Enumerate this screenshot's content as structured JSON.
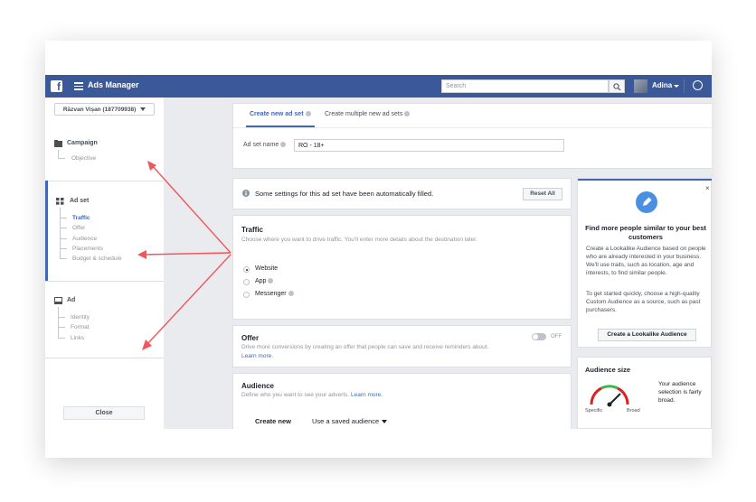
{
  "topbar": {
    "logo": "f",
    "app_title": "Ads Manager",
    "search_placeholder": "Search",
    "user_name": "Adina"
  },
  "sidebar": {
    "account_selector": "Răzvan Vișan (187709938)",
    "campaign": {
      "title": "Campaign",
      "items": [
        "Objective"
      ]
    },
    "adset": {
      "title": "Ad set",
      "items": [
        "Traffic",
        "Offer",
        "Audience",
        "Placements",
        "Budget & schedule"
      ],
      "active_item": "Traffic"
    },
    "ad": {
      "title": "Ad",
      "items": [
        "Identity",
        "Format",
        "Links"
      ]
    },
    "close_label": "Close"
  },
  "adset_header": {
    "tabs": [
      "Create new ad set",
      "Create multiple new ad sets"
    ],
    "active_tab": "Create new ad set",
    "name_label": "Ad set name",
    "name_value": "RO - 18+"
  },
  "notice": {
    "text": "Some settings for this ad set have been automatically filled.",
    "reset_label": "Reset All"
  },
  "traffic": {
    "title": "Traffic",
    "description": "Choose where you want to drive traffic. You'll enter more details about the destination later.",
    "options": [
      "Website",
      "App",
      "Messenger"
    ],
    "selected": "Website"
  },
  "offer": {
    "title": "Offer",
    "description": "Drive more conversions by creating an offer that people can save and receive reminders about.",
    "learn_more": "Learn more.",
    "toggle_label": "OFF"
  },
  "audience": {
    "title": "Audience",
    "description": "Define who you want to see your adverts.",
    "learn_more": "Learn more.",
    "create_new": "Create new",
    "saved": "Use a saved audience"
  },
  "lookalike": {
    "title": "Find more people similar to your best customers",
    "text1": "Create a Lookalike Audience based on people who are already interested in your business. We'll use traits, such as location, age and interests, to find similar people.",
    "text2": "To get started quickly, choose a high-quality Custom Audience as a source, such as past purchasers.",
    "button": "Create a Lookalike Audience",
    "close": "×"
  },
  "audience_size": {
    "title": "Audience size",
    "text": "Your audience selection is fairly broad.",
    "specific_label": "Specific",
    "broad_label": "Broad"
  },
  "colors": {
    "topbar": "#3b5998",
    "accent": "#4267b2",
    "arrow": "#f0565c"
  }
}
